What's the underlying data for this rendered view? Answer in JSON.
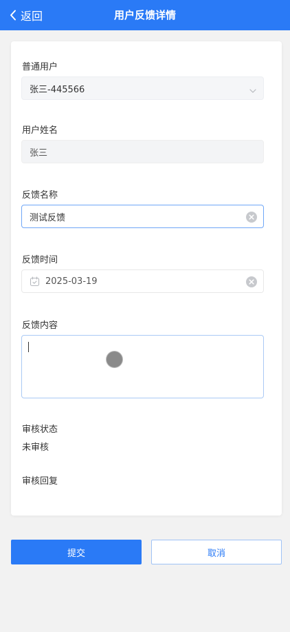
{
  "header": {
    "back_label": "返回",
    "title": "用户反馈详情"
  },
  "form": {
    "user": {
      "label": "普通用户",
      "value": "张三-445566"
    },
    "user_name": {
      "label": "用户姓名",
      "value": "张三"
    },
    "feedback_name": {
      "label": "反馈名称",
      "value": "测试反馈"
    },
    "feedback_time": {
      "label": "反馈时间",
      "value": "2025-03-19"
    },
    "feedback_content": {
      "label": "反馈内容",
      "value": ""
    },
    "review_status": {
      "label": "审核状态",
      "value": "未审核"
    },
    "review_reply": {
      "label": "审核回复",
      "value": ""
    }
  },
  "actions": {
    "submit_label": "提交",
    "cancel_label": "取消"
  },
  "colors": {
    "brand": "#2a7af6",
    "page_background": "#f2f2f2",
    "focus_border": "#6ea6f7"
  },
  "icons": {
    "back": "chevron-left-icon",
    "select": "chevron-down-icon",
    "clear": "clear-circle-icon",
    "date": "calendar-icon"
  }
}
